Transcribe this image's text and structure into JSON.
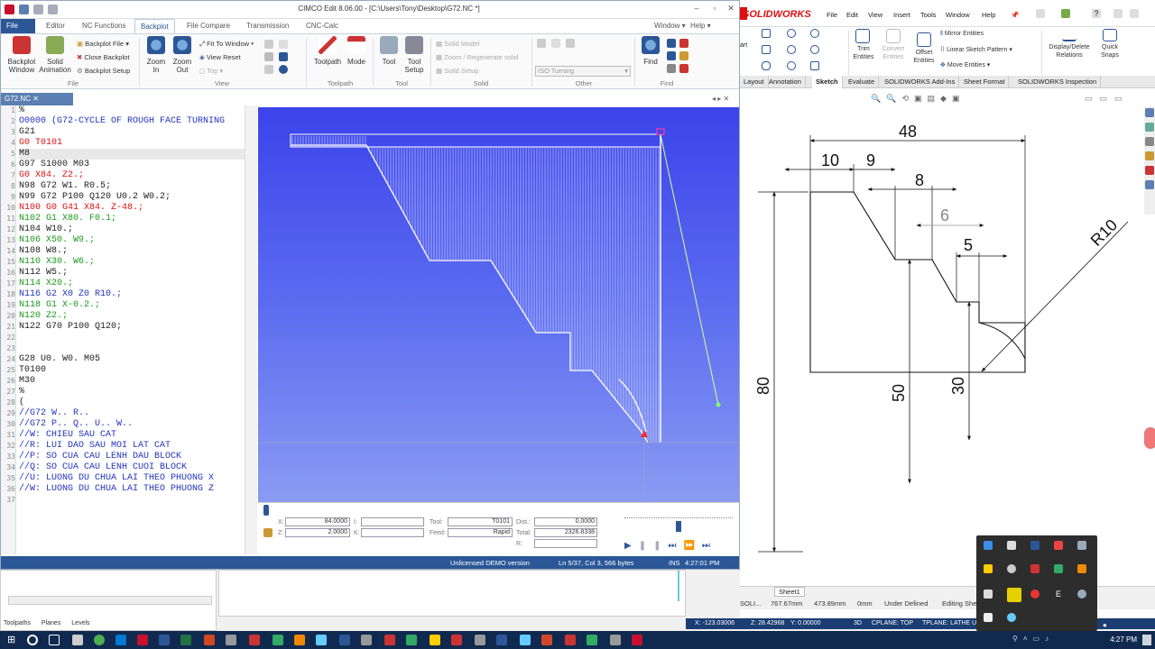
{
  "cimco": {
    "title": "CIMCO Edit 8.06.00 - [C:\\Users\\Tony\\Desktop\\G72.NC *]",
    "tabs": [
      "File",
      "Editor",
      "NC Functions",
      "Backplot",
      "File Compare",
      "Transmission",
      "CNC-Calc"
    ],
    "window_menu": "Window",
    "help_menu": "Help",
    "ribbon": {
      "backplot_window": "Backplot Window",
      "solid_animation": "Solid Animation",
      "backplot_file": "Backplot File",
      "close_backplot": "Close Backplot",
      "backplot_setup": "Backplot Setup",
      "group_file": "File",
      "zoom_in": "Zoom In",
      "zoom_out": "Zoom Out",
      "fit_to_window": "Fit To Window",
      "view_reset": "View Reset",
      "top": "Top",
      "group_view": "View",
      "toolpath": "Toolpath",
      "mode": "Mode",
      "group_toolpath": "Toolpath",
      "tool": "Tool",
      "tool_setup": "Tool Setup",
      "group_tool": "Tool",
      "solid_model": "Solid Model",
      "zoom_regenerate": "Zoom / Regenerate solid",
      "solid_setup": "Solid Setup",
      "group_solid": "Solid",
      "iso_turning": "ISO Turning",
      "group_other": "Other",
      "find": "Find",
      "group_find": "Find"
    },
    "doc_tab": "G72.NC",
    "code_lines": [
      {
        "n": "1",
        "t": "%",
        "c": "#222"
      },
      {
        "n": "2",
        "t": "O0000 (G72-CYCLE OF ROUGH FACE TURNING",
        "c": "#2233bb"
      },
      {
        "n": "3",
        "t": "G21",
        "c": "#222"
      },
      {
        "n": "4",
        "t": "G0 T0101",
        "c": "#d11"
      },
      {
        "n": "5",
        "t": "M8",
        "c": "#222"
      },
      {
        "n": "6",
        "t": "G97 S1000 M03",
        "c": "#222"
      },
      {
        "n": "7",
        "t": "G0 X84. Z2.;",
        "c": "#d11"
      },
      {
        "n": "8",
        "t": "N98 G72 W1. R0.5;",
        "c": "#222"
      },
      {
        "n": "9",
        "t": "N99 G72 P100 Q120 U0.2 W0.2;",
        "c": "#222"
      },
      {
        "n": "10",
        "t": "N100 G0 G41 X84. Z-48.;",
        "c": "#d11"
      },
      {
        "n": "11",
        "t": "N102 G1 X80. F0.1;",
        "c": "#1a9a1a"
      },
      {
        "n": "12",
        "t": "N104 W10.;",
        "c": "#222"
      },
      {
        "n": "13",
        "t": "N106 X50. W9.;",
        "c": "#1a9a1a"
      },
      {
        "n": "14",
        "t": "N108 W8.;",
        "c": "#222"
      },
      {
        "n": "15",
        "t": "N110 X30. W6.;",
        "c": "#1a9a1a"
      },
      {
        "n": "16",
        "t": "N112 W5.;",
        "c": "#222"
      },
      {
        "n": "17",
        "t": "N114 X20.;",
        "c": "#1a9a1a"
      },
      {
        "n": "18",
        "t": "N116 G2 X0 Z0 R10.;",
        "c": "#2233bb"
      },
      {
        "n": "19",
        "t": "N118 G1 X-0.2.;",
        "c": "#1a9a1a"
      },
      {
        "n": "20",
        "t": "N120 Z2.;",
        "c": "#1a9a1a"
      },
      {
        "n": "21",
        "t": "N122 G70 P100 Q120;",
        "c": "#222"
      },
      {
        "n": "22",
        "t": "",
        "c": "#222"
      },
      {
        "n": "23",
        "t": "",
        "c": "#222"
      },
      {
        "n": "24",
        "t": "G28 U0. W0. M05",
        "c": "#222"
      },
      {
        "n": "25",
        "t": "T0100",
        "c": "#222"
      },
      {
        "n": "26",
        "t": "M30",
        "c": "#222"
      },
      {
        "n": "27",
        "t": "%",
        "c": "#222"
      },
      {
        "n": "28",
        "t": "(",
        "c": "#222"
      },
      {
        "n": "29",
        "t": "//G72 W.. R..",
        "c": "#2233bb"
      },
      {
        "n": "30",
        "t": "//G72 P.. Q.. U.. W..",
        "c": "#2233bb"
      },
      {
        "n": "31",
        "t": "//W: CHIEU SAU CAT",
        "c": "#2233bb"
      },
      {
        "n": "32",
        "t": "//R: LUI DAO SAU MOI LAT CAT",
        "c": "#2233bb"
      },
      {
        "n": "33",
        "t": "//P: SO CUA CAU LENH DAU BLOCK",
        "c": "#2233bb"
      },
      {
        "n": "34",
        "t": "//Q: SO CUA CAU LENH CUOI BLOCK",
        "c": "#2233bb"
      },
      {
        "n": "35",
        "t": "//U: LUONG DU CHUA LAI THEO PHUONG X",
        "c": "#2233bb"
      },
      {
        "n": "36",
        "t": "//W: LUONG DU CHUA LAI THEO PHUONG Z",
        "c": "#2233bb"
      },
      {
        "n": "37",
        "t": "",
        "c": "#222"
      }
    ],
    "backplot_info": {
      "x_label": "X:",
      "x_value": "84.0000",
      "z_label": "Z:",
      "z_value": "2.0000",
      "i_label": "I:",
      "k_label": "K:",
      "tool_label": "Tool:",
      "tool_value": "T0101",
      "feed_label": "Feed:",
      "feed_value": "Rapid",
      "dist_label": "Dist.:",
      "dist_value": "0.0000",
      "total_label": "Total:",
      "total_value": "2326.8338",
      "r_label": "R:"
    },
    "status": {
      "license": "Unlicensed DEMO version",
      "position": "Ln 5/37, Col 3, 566 bytes",
      "ins": "INS",
      "time": "4:27:01 PM"
    }
  },
  "lower_panel": {
    "tabs": [
      "Toolpaths",
      "Planes",
      "Levels"
    ]
  },
  "solidworks": {
    "logo": "SOLIDWORKS",
    "menus": [
      "File",
      "Edit",
      "View",
      "Insert",
      "Tools",
      "Window",
      "Help"
    ],
    "commands": {
      "trim_entities": "Trim Entities",
      "convert_entities": "Convert Entities",
      "offset_entities": "Offset Entities",
      "mirror_entities": "Mirror Entities",
      "linear_sketch_pattern": "Linear Sketch Pattern",
      "move_entities": "Move Entities",
      "display_delete_relations": "Display/Delete Relations",
      "quick_snaps": "Quick Snaps",
      "smart_fragment": "art"
    },
    "tabs": [
      "Layout",
      "Annotation",
      "Sketch",
      "Evaluate",
      "SOLIDWORKS Add-Ins",
      "Sheet Format",
      "SOLIDWORKS Inspection"
    ],
    "active_tab": "Sketch",
    "dimensions": {
      "d48": "48",
      "d10": "10",
      "d9": "9",
      "d8": "8",
      "d6": "6",
      "d5": "5",
      "r10": "R10",
      "d80": "80",
      "d50": "50",
      "d30": "30"
    },
    "sheet_tab": "Sheet1",
    "status": {
      "prefix": "SOLI...",
      "x": "767.67mm",
      "y": "473.89mm",
      "z": "0mm",
      "state": "Under Defined",
      "editing": "Editing Sheet1"
    }
  },
  "coords": {
    "x": "X: -123.03006",
    "z": "Z: 28.42968",
    "y": "Y: 0.00000",
    "mode": "3D",
    "cplane": "CPLANE: TOP",
    "tplane": "TPLANE: LATHE UP"
  },
  "taskbar": {
    "time": "4:27 PM"
  }
}
